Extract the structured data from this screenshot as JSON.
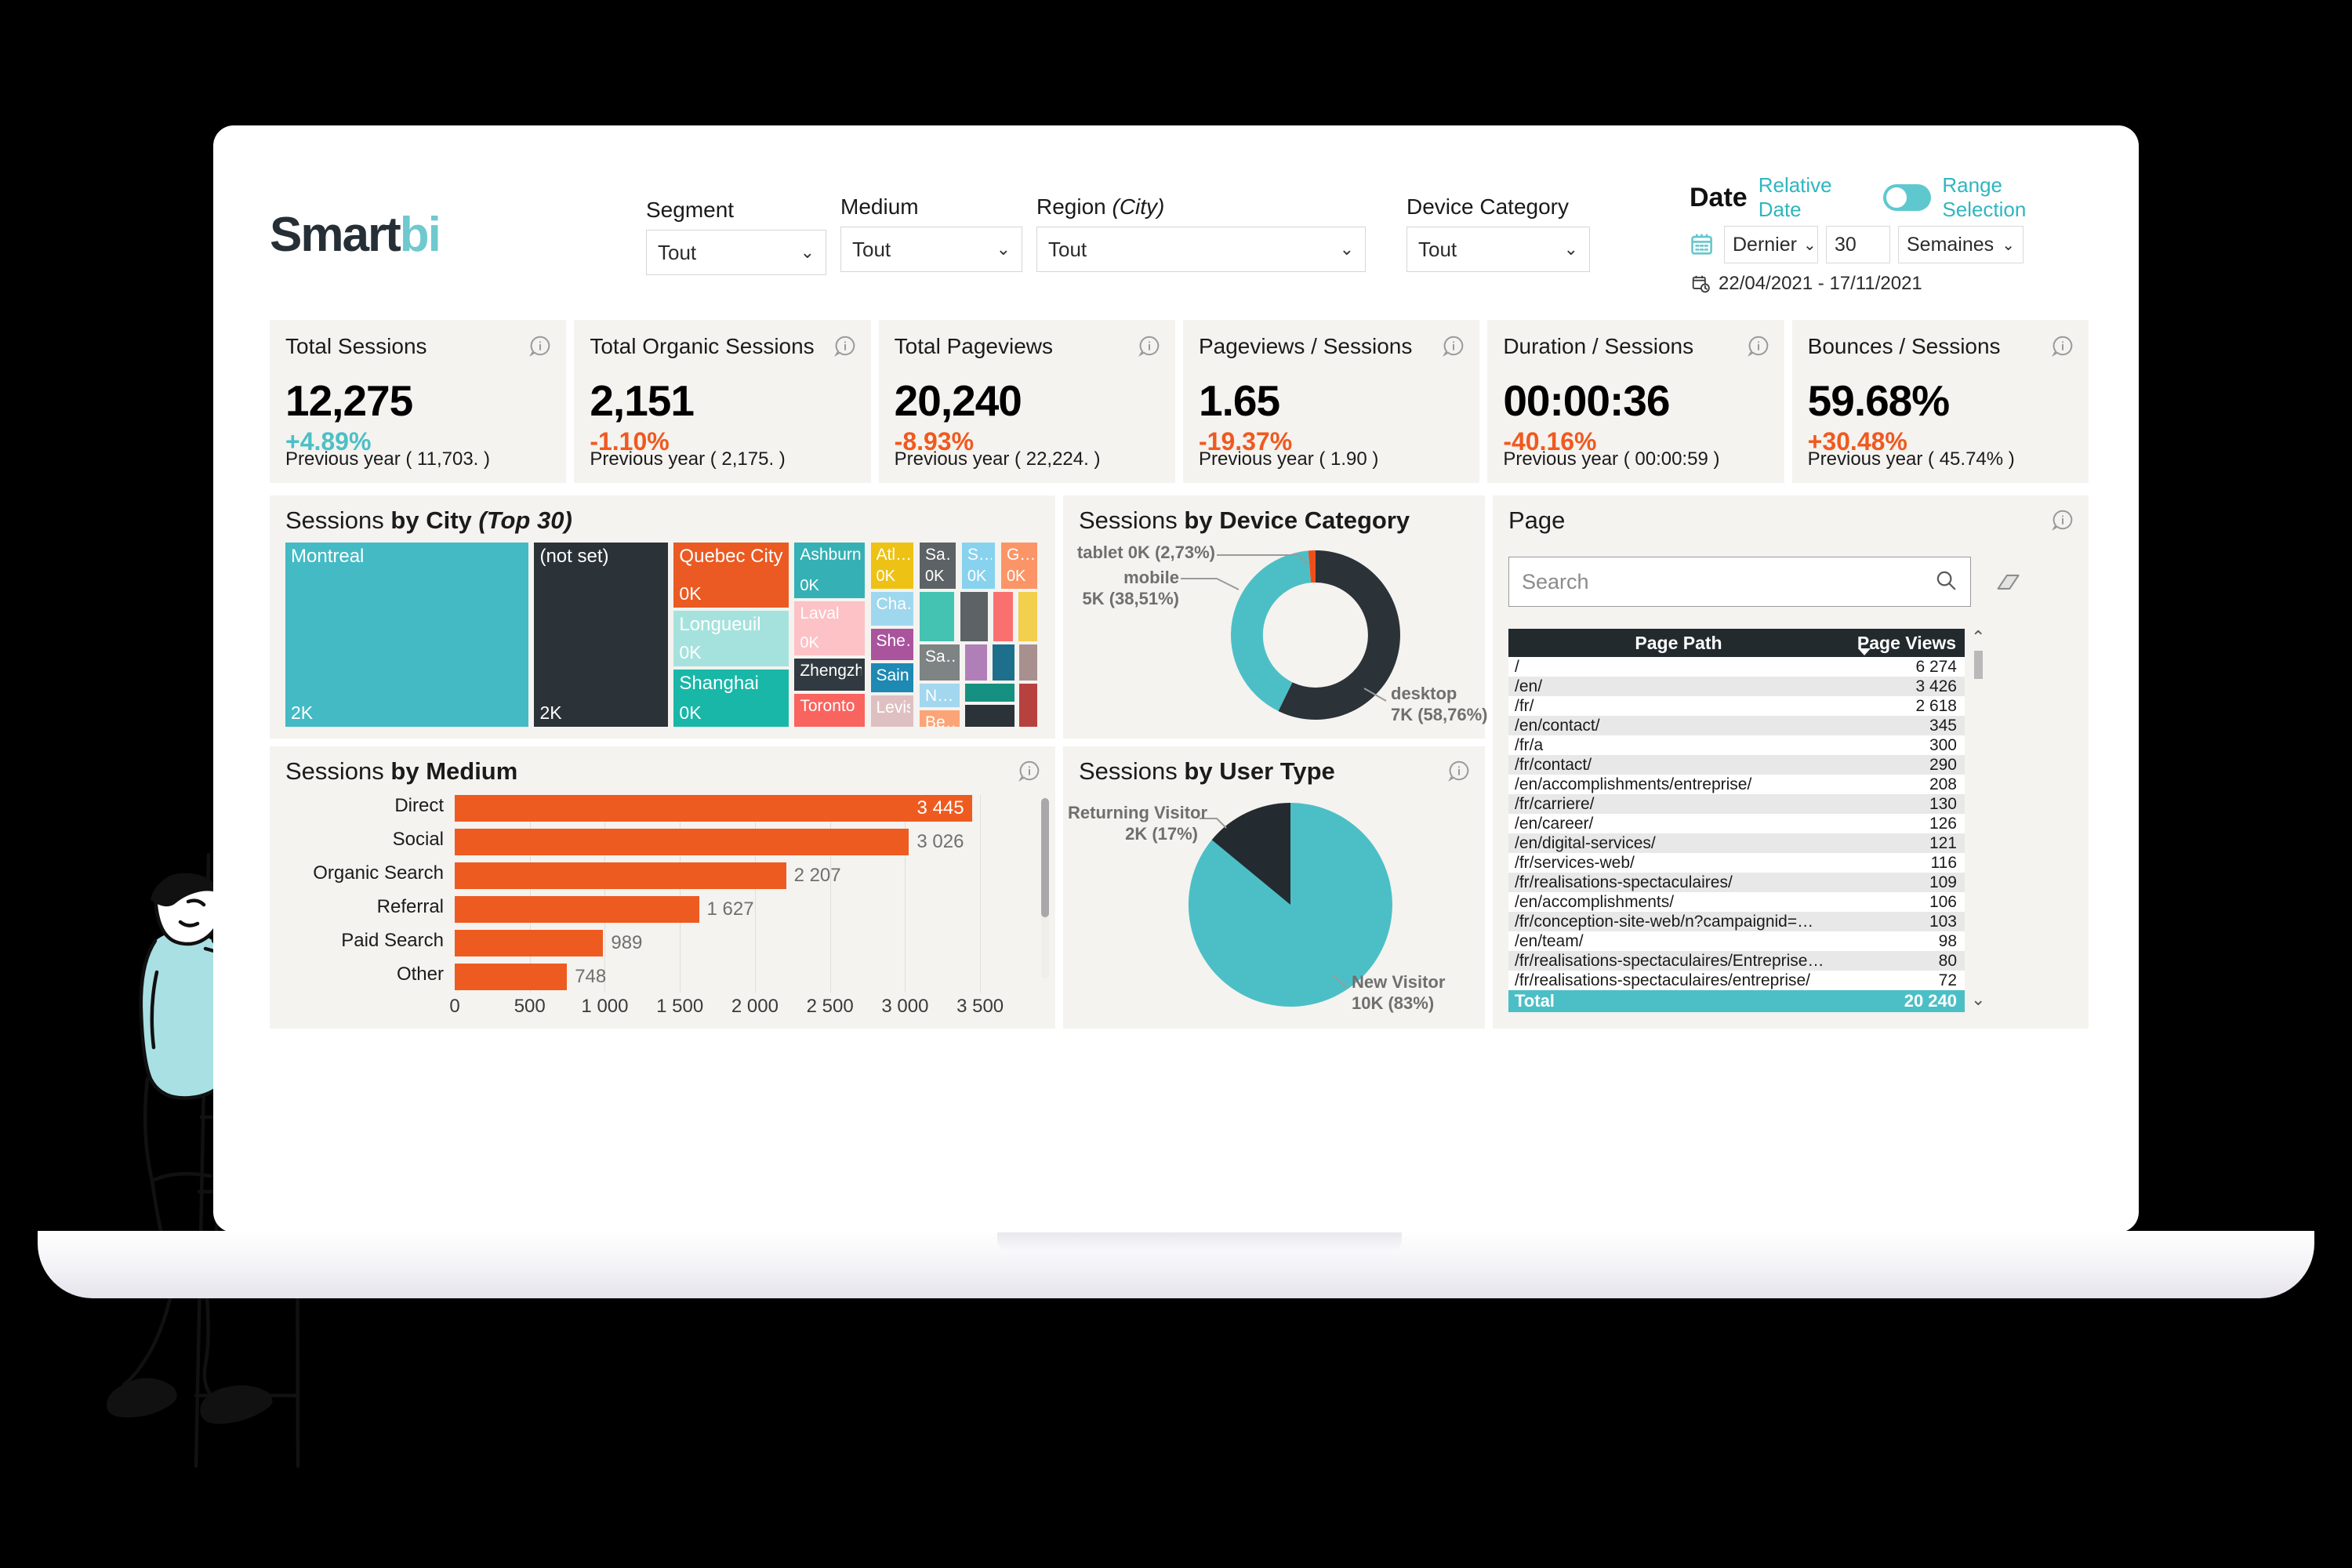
{
  "brand": {
    "name_dark": "Smart",
    "name_light": "bi"
  },
  "filters": [
    {
      "label": "Segment",
      "value": "Tout"
    },
    {
      "label": "Medium",
      "value": "Tout"
    },
    {
      "label": "Region ",
      "label_em": "(City)",
      "value": "Tout"
    },
    {
      "label": "Device Category",
      "value": "Tout"
    }
  ],
  "date": {
    "title": "Date",
    "relative_link": "Relative Date",
    "range_link": "Range Selection",
    "toggle_on": false,
    "mode": "Dernier",
    "amount": "30",
    "unit": "Semaines",
    "range_text": "22/04/2021 - 17/11/2021"
  },
  "kpis": [
    {
      "title": "Total Sessions",
      "value": "12,275",
      "delta": "+4.89%",
      "delta_color": "#4cbfc6",
      "previous": "Previous year ( 11,703. )"
    },
    {
      "title": "Total Organic Sessions",
      "value": "2,151",
      "delta": "-1.10%",
      "delta_color": "#f0591f",
      "previous": "Previous year ( 2,175. )"
    },
    {
      "title": "Total Pageviews",
      "value": "20,240",
      "delta": "-8.93%",
      "delta_color": "#f0591f",
      "previous": "Previous year ( 22,224. )"
    },
    {
      "title": "Pageviews / Sessions",
      "value": "1.65",
      "delta": "-19.37%",
      "delta_color": "#f0591f",
      "previous": "Previous year ( 1.90 )"
    },
    {
      "title": "Duration / Sessions",
      "value": "00:00:36",
      "delta": "-40.16%",
      "delta_color": "#f0591f",
      "previous": "Previous year ( 00:00:59 )"
    },
    {
      "title": "Bounces / Sessions",
      "value": "59.68%",
      "delta": "+30.48%",
      "delta_color": "#f0591f",
      "previous": "Previous year ( 45.74% )"
    }
  ],
  "panels": {
    "city": {
      "title_plain": "Sessions ",
      "title_bold": "by City ",
      "title_em": "(Top 30)"
    },
    "medium": {
      "title_plain": "Sessions ",
      "title_bold": "by Medium"
    },
    "device": {
      "title_plain": "Sessions ",
      "title_bold": "by Device Category"
    },
    "user": {
      "title_plain": "Sessions ",
      "title_bold": "by User Type"
    },
    "page": {
      "title_plain": "Page"
    }
  },
  "search": {
    "placeholder": "Search"
  },
  "page_table": {
    "headers": {
      "path": "Page Path",
      "views": "Page Views"
    },
    "rows": [
      {
        "path": "/",
        "views": "6 274"
      },
      {
        "path": "/en/",
        "views": "3 426"
      },
      {
        "path": "/fr/",
        "views": "2 618"
      },
      {
        "path": "/en/contact/",
        "views": "345"
      },
      {
        "path": "/fr/a",
        "views": "300"
      },
      {
        "path": "/fr/contact/",
        "views": "290"
      },
      {
        "path": "/en/accomplishments/entreprise/",
        "views": "208"
      },
      {
        "path": "/fr/carriere/",
        "views": "130"
      },
      {
        "path": "/en/career/",
        "views": "126"
      },
      {
        "path": "/en/digital-services/",
        "views": "121"
      },
      {
        "path": "/fr/services-web/",
        "views": "116"
      },
      {
        "path": "/fr/realisations-spectaculaires/",
        "views": "109"
      },
      {
        "path": "/en/accomplishments/",
        "views": "106"
      },
      {
        "path": "/fr/conception-site-web/n?campaignid=…",
        "views": "103"
      },
      {
        "path": "/en/team/",
        "views": "98"
      },
      {
        "path": "/fr/realisations-spectaculaires/Entreprise…",
        "views": "80"
      },
      {
        "path": "/fr/realisations-spectaculaires/entreprise/",
        "views": "72"
      }
    ],
    "total": {
      "label": "Total",
      "views": "20 240"
    }
  },
  "chart_data": [
    {
      "type": "treemap",
      "title": "Sessions by City (Top 30)",
      "value_unit": "sessions",
      "tiles": [
        {
          "name": "Montreal",
          "label": "2K",
          "color": "#44bac4",
          "x": 0,
          "y": 0,
          "w": 32.5,
          "h": 100
        },
        {
          "name": "(not set)",
          "label": "2K",
          "color": "#2b3238",
          "x": 33.0,
          "y": 0,
          "w": 18.0,
          "h": 100
        },
        {
          "name": "Quebec City",
          "label": "0K",
          "color": "#ea5a22",
          "x": 51.5,
          "y": 0,
          "w": 15.5,
          "h": 36.0
        },
        {
          "name": "Longueuil",
          "label": "0K",
          "color": "#a6e2dd",
          "x": 51.5,
          "y": 36.6,
          "w": 15.5,
          "h": 31.0
        },
        {
          "name": "Shanghai",
          "label": "0K",
          "color": "#19b7a8",
          "x": 51.5,
          "y": 68.2,
          "w": 15.5,
          "h": 31.8
        },
        {
          "name": "Ashburn",
          "label": "0K",
          "color": "#35b0b5",
          "x": 67.5,
          "y": 0,
          "w": 9.6,
          "h": 31.0
        },
        {
          "name": "Laval",
          "label": "0K",
          "color": "#fcc2c6",
          "x": 67.5,
          "y": 31.6,
          "w": 9.6,
          "h": 30.0
        },
        {
          "name": "Zhengzhou",
          "label": "",
          "color": "#303a40",
          "x": 67.5,
          "y": 62.2,
          "w": 9.6,
          "h": 18.5
        },
        {
          "name": "Toronto",
          "label": "",
          "color": "#f9645f",
          "x": 67.5,
          "y": 81.3,
          "w": 9.6,
          "h": 18.7
        },
        {
          "name": "Atl…",
          "label": "0K",
          "color": "#edc215",
          "x": 77.6,
          "y": 0,
          "w": 6.0,
          "h": 26.0
        },
        {
          "name": "Sa…",
          "label": "0K",
          "color": "#5c6265",
          "x": 84.1,
          "y": 0,
          "w": 5.1,
          "h": 26.0
        },
        {
          "name": "S…",
          "label": "0K",
          "color": "#87d2ef",
          "x": 89.7,
          "y": 0,
          "w": 4.7,
          "h": 26.0
        },
        {
          "name": "G…",
          "label": "0K",
          "color": "#fb9567",
          "x": 94.9,
          "y": 0,
          "w": 5.1,
          "h": 26.0
        },
        {
          "name": "Cha…",
          "label": "",
          "color": "#9fd8ee",
          "x": 77.6,
          "y": 26.6,
          "w": 6.0,
          "h": 19.0
        },
        {
          "name": "She…",
          "label": "",
          "color": "#a9549d",
          "x": 77.6,
          "y": 46.1,
          "w": 6.0,
          "h": 18.0
        },
        {
          "name": "Sain…",
          "label": "",
          "color": "#1e89b3",
          "x": 77.6,
          "y": 64.6,
          "w": 6.0,
          "h": 17.0
        },
        {
          "name": "Levis",
          "label": "",
          "color": "#dfc0c2",
          "x": 77.6,
          "y": 82.1,
          "w": 6.0,
          "h": 17.9
        },
        {
          "name": "",
          "label": "",
          "color": "#45c3b2",
          "x": 84.1,
          "y": 26.6,
          "w": 4.9,
          "h": 27.5
        },
        {
          "name": "",
          "label": "",
          "color": "#5c6265",
          "x": 89.5,
          "y": 26.6,
          "w": 4.0,
          "h": 27.5
        },
        {
          "name": "",
          "label": "",
          "color": "#f9706f",
          "x": 93.9,
          "y": 26.6,
          "w": 2.9,
          "h": 27.5
        },
        {
          "name": "",
          "label": "",
          "color": "#f2cf4c",
          "x": 97.2,
          "y": 26.6,
          "w": 2.8,
          "h": 27.5
        },
        {
          "name": "Sa…",
          "label": "",
          "color": "#7e8384",
          "x": 84.1,
          "y": 54.6,
          "w": 5.6,
          "h": 20.5
        },
        {
          "name": "N…",
          "label": "",
          "color": "#a3d6ef",
          "x": 84.1,
          "y": 75.6,
          "w": 5.6,
          "h": 14.0
        },
        {
          "name": "Be…",
          "label": "",
          "color": "#fba477",
          "x": 84.1,
          "y": 90.0,
          "w": 5.6,
          "h": 10.0
        },
        {
          "name": "",
          "label": "",
          "color": "#b07fb8",
          "x": 90.1,
          "y": 54.6,
          "w": 3.3,
          "h": 20.5
        },
        {
          "name": "",
          "label": "",
          "color": "#1d6f8b",
          "x": 93.8,
          "y": 54.6,
          "w": 3.2,
          "h": 20.5
        },
        {
          "name": "",
          "label": "",
          "color": "#a8908f",
          "x": 97.3,
          "y": 54.6,
          "w": 2.7,
          "h": 20.5
        },
        {
          "name": "",
          "label": "",
          "color": "#169080",
          "x": 90.1,
          "y": 75.6,
          "w": 6.9,
          "h": 11.0
        },
        {
          "name": "",
          "label": "",
          "color": "#2b3238",
          "x": 90.1,
          "y": 87.0,
          "w": 6.9,
          "h": 13.0
        },
        {
          "name": "",
          "label": "",
          "color": "#b7413f",
          "x": 97.3,
          "y": 75.6,
          "w": 2.7,
          "h": 24.4
        }
      ]
    },
    {
      "type": "bar",
      "orientation": "horizontal",
      "title": "Sessions by Medium",
      "categories": [
        "Direct",
        "Social",
        "Organic Search",
        "Referral",
        "Paid Search",
        "Other"
      ],
      "values": [
        3445,
        3026,
        2207,
        1627,
        989,
        748
      ],
      "value_labels": [
        "3 445",
        "3 026",
        "2 207",
        "1 627",
        "989",
        "748"
      ],
      "bar_color": "#ee5b20",
      "xlabel": "",
      "ylabel": "",
      "xlim": [
        0,
        3750
      ],
      "xticks": [
        0,
        500,
        1000,
        1500,
        2000,
        2500,
        3000,
        3500
      ],
      "xtick_labels": [
        "0",
        "500",
        "1 000",
        "1 500",
        "2 000",
        "2 500",
        "3 000",
        "3 500"
      ],
      "grid": true
    },
    {
      "type": "pie",
      "variant": "donut",
      "title": "Sessions by Device Category",
      "labels": [
        "desktop",
        "mobile",
        "tablet"
      ],
      "values": [
        58.76,
        38.51,
        2.73
      ],
      "value_labels": [
        "7K (58,76%)",
        "5K (38,51%)",
        "0K (2,73%)"
      ],
      "colors": [
        "#2b3238",
        "#4cbfc6",
        "#f04e18"
      ],
      "legend": "callout"
    },
    {
      "type": "pie",
      "title": "Sessions by User Type",
      "labels": [
        "New Visitor",
        "Returning Visitor"
      ],
      "values": [
        83,
        17
      ],
      "value_labels": [
        "10K (83%)",
        "2K (17%)"
      ],
      "colors": [
        "#4cbfc6",
        "#232b30"
      ],
      "legend": "callout"
    }
  ],
  "colors": {
    "accent_teal": "#4cbfc6",
    "accent_orange": "#ee5b20",
    "panel_bg": "#f4f3ef",
    "dark": "#2b3238"
  }
}
